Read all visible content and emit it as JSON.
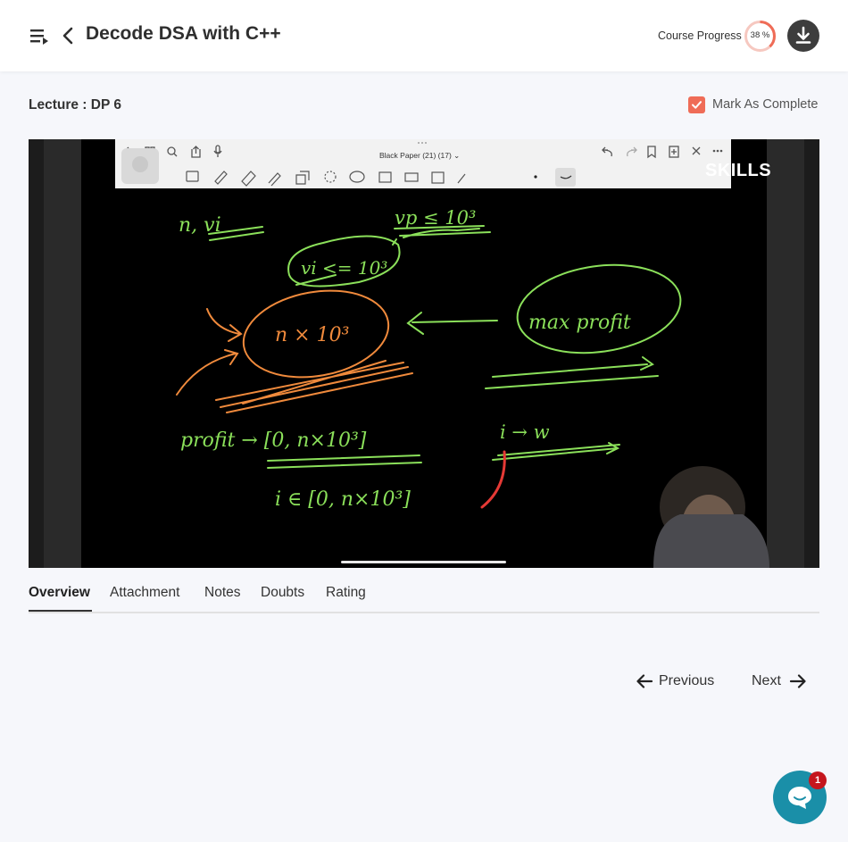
{
  "header": {
    "course_title": "Decode DSA with C++",
    "progress_label": "Course Progress",
    "progress_text": "38 %",
    "progress_value": 38,
    "menu_icon": "playlist-menu-icon",
    "back_icon": "chevron-left-icon",
    "download_icon": "download-icon"
  },
  "lecture": {
    "title": "Lecture : DP 6",
    "mark_complete_label": "Mark As Complete",
    "mark_complete_checked": true
  },
  "video": {
    "toolbar_title": "Black Paper  (21) (17) ⌄",
    "brand": "SKILLS",
    "whiteboard_text": {
      "n_vi": "n, vi",
      "vp_constraint": "vp ≤ 10³",
      "vi_constraint": "vi <= 10³",
      "n_times": "n × 10³",
      "max_profit": "max profit",
      "profit_range": "profit → [0, n×10³]",
      "i_to_w": "i → w",
      "i_range": "i ∈ [0, n×10³]"
    }
  },
  "tabs": [
    {
      "label": "Overview",
      "active": true
    },
    {
      "label": "Attachment",
      "active": false
    },
    {
      "label": "Notes",
      "active": false
    },
    {
      "label": "Doubts",
      "active": false
    },
    {
      "label": "Rating",
      "active": false
    }
  ],
  "navigation": {
    "previous_label": "Previous",
    "next_label": "Next"
  },
  "chat": {
    "badge_count": "1",
    "icon": "chat-bubble-icon"
  },
  "colors": {
    "accent": "#ef6c57",
    "chat": "#1a8fa8",
    "badge": "#c5161d",
    "chalk_green": "#8be05a",
    "chalk_orange": "#f08a3c",
    "chalk_red": "#e53935"
  }
}
